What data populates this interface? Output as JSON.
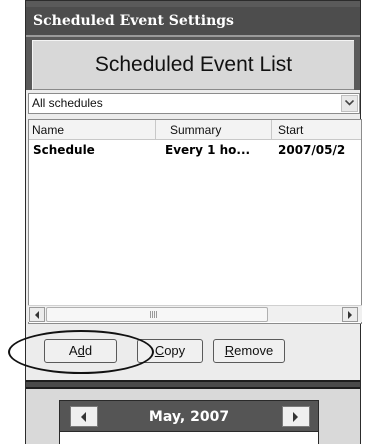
{
  "window": {
    "title": "Scheduled Event Settings"
  },
  "panel": {
    "title": "Scheduled Event List"
  },
  "filter": {
    "selected": "All schedules"
  },
  "list": {
    "columns": [
      "Name",
      "Summary",
      "Start"
    ],
    "rows": [
      {
        "name": "Schedule",
        "summary": "Every 1 ho...",
        "start": "2007/05/2"
      }
    ]
  },
  "buttons": {
    "add": {
      "pre": "A",
      "key": "d",
      "post": "d"
    },
    "copy": {
      "pre": "",
      "key": "C",
      "post": "opy"
    },
    "remove": {
      "pre": "",
      "key": "R",
      "post": "emove"
    }
  },
  "calendar": {
    "month": "May, 2007"
  },
  "icons": {
    "dropdown": "chevron-down-icon",
    "scroll_left": "arrow-left-icon",
    "scroll_right": "arrow-right-icon",
    "prev_month": "arrow-left-icon",
    "next_month": "arrow-right-icon"
  }
}
